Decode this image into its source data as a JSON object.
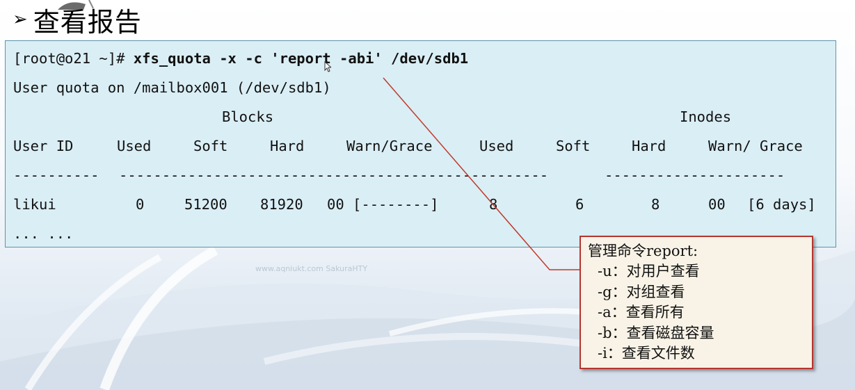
{
  "slide": {
    "title_bullet": "➢",
    "title": "查看报告",
    "watermark": "www.aqniukt.com SakuraHTY"
  },
  "terminal": {
    "prompt": "[root@o21 ~]# ",
    "command": "xfs_quota -x -c 'report -abi' /dev/sdb1",
    "line2": "User quota on /mailbox001 (/dev/sdb1)",
    "group_blocks": "Blocks",
    "group_inodes": "Inodes",
    "headers": [
      "User ID",
      "Used",
      "Soft",
      "Hard",
      "Warn/Grace",
      "Used",
      "Soft",
      "Hard",
      "Warn/ Grace"
    ],
    "dash_col1": "----------",
    "dash_col2": "--------------------------------------------------",
    "dash_col3": "---------------------",
    "row": [
      "likui",
      "0",
      "51200",
      "81920",
      "00 [--------]",
      "8",
      "6",
      "8",
      "00",
      "[6 days]"
    ],
    "ellipsis": "... ..."
  },
  "note": {
    "title": "管理命令report:",
    "items": [
      "-u：对用户查看",
      "-g：对组查看",
      "-a：查看所有",
      "-b：查看磁盘容量",
      "-i：查看文件数"
    ]
  }
}
